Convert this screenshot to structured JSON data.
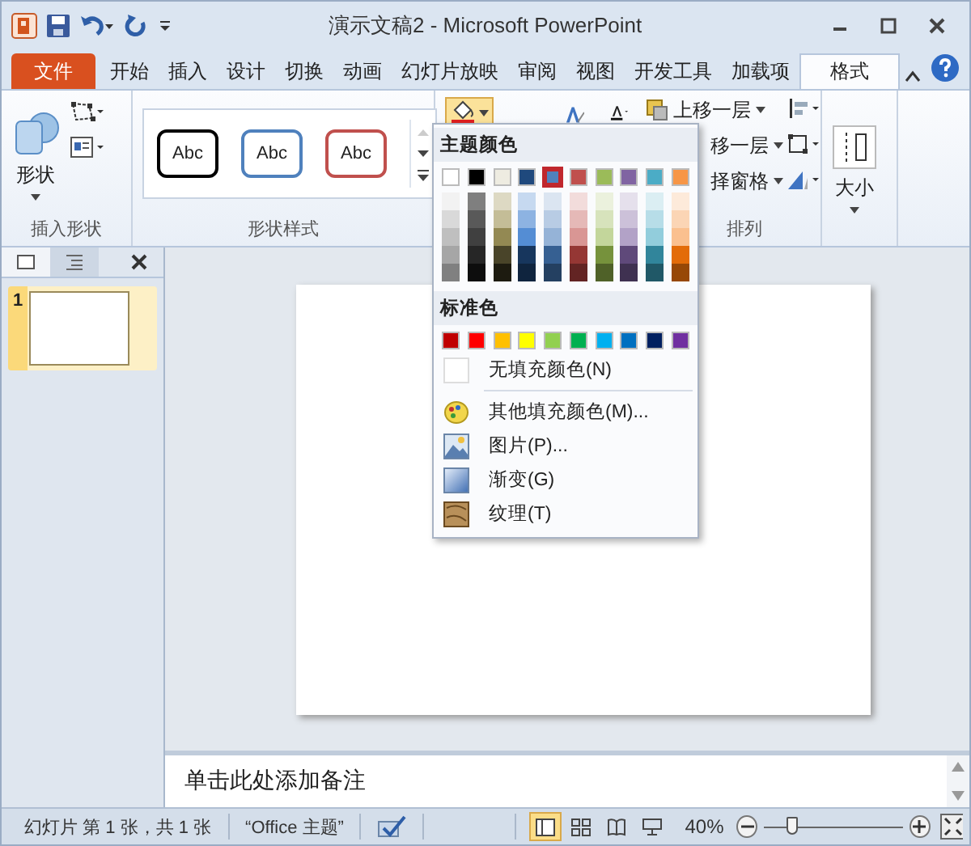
{
  "window": {
    "title": "演示文稿2  -  Microsoft PowerPoint"
  },
  "tabs": [
    {
      "label": "文件",
      "kind": "file",
      "selected": false
    },
    {
      "label": "开始",
      "kind": "tab",
      "selected": false
    },
    {
      "label": "插入",
      "kind": "tab",
      "selected": false
    },
    {
      "label": "设计",
      "kind": "tab",
      "selected": false
    },
    {
      "label": "切换",
      "kind": "tab",
      "selected": false
    },
    {
      "label": "动画",
      "kind": "tab",
      "selected": false
    },
    {
      "label": "幻灯片放映",
      "kind": "tab",
      "selected": false
    },
    {
      "label": "审阅",
      "kind": "tab",
      "selected": false
    },
    {
      "label": "视图",
      "kind": "tab",
      "selected": false
    },
    {
      "label": "开发工具",
      "kind": "tab",
      "selected": false
    },
    {
      "label": "加载项",
      "kind": "tab",
      "selected": false
    },
    {
      "label": "格式",
      "kind": "tab",
      "selected": true
    }
  ],
  "ribbon": {
    "insert_shapes": {
      "label": "插入形状",
      "shapes_button": "形状"
    },
    "shape_styles": {
      "label": "形状样式",
      "styles": [
        {
          "text": "Abc",
          "color": "#000000"
        },
        {
          "text": "Abc",
          "color": "#4f81bd"
        },
        {
          "text": "Abc",
          "color": "#c0504d"
        }
      ]
    },
    "arrange": {
      "label": "排列",
      "items": [
        "上移一层",
        "移一层",
        "择窗格"
      ]
    },
    "size": {
      "label": "大小"
    }
  },
  "fill_menu": {
    "theme_heading": "主题颜色",
    "theme_colors": [
      {
        "color": "#ffffff",
        "selected": false,
        "shades": [
          {
            "color": "#f2f2f2"
          },
          {
            "color": "#d9d9d9"
          },
          {
            "color": "#bfbfbf"
          },
          {
            "color": "#a6a6a6"
          },
          {
            "color": "#808080"
          }
        ]
      },
      {
        "color": "#000000",
        "selected": false,
        "shades": [
          {
            "color": "#7f7f7f"
          },
          {
            "color": "#595959"
          },
          {
            "color": "#404040"
          },
          {
            "color": "#262626"
          },
          {
            "color": "#0d0d0d"
          }
        ]
      },
      {
        "color": "#eeece1",
        "selected": false,
        "shades": [
          {
            "color": "#ddd9c3"
          },
          {
            "color": "#c4bd97"
          },
          {
            "color": "#938953"
          },
          {
            "color": "#494429"
          },
          {
            "color": "#1d1b10"
          }
        ]
      },
      {
        "color": "#1f497d",
        "selected": false,
        "shades": [
          {
            "color": "#c6d9f0"
          },
          {
            "color": "#8db3e2"
          },
          {
            "color": "#548dd4"
          },
          {
            "color": "#17365d"
          },
          {
            "color": "#0f243e"
          }
        ]
      },
      {
        "color": "#4f81bd",
        "selected": true,
        "shades": [
          {
            "color": "#dbe5f1"
          },
          {
            "color": "#b8cce4"
          },
          {
            "color": "#95b3d7"
          },
          {
            "color": "#366092"
          },
          {
            "color": "#244061"
          }
        ]
      },
      {
        "color": "#c0504d",
        "selected": false,
        "shades": [
          {
            "color": "#f2dcdb"
          },
          {
            "color": "#e5b9b7"
          },
          {
            "color": "#d99694"
          },
          {
            "color": "#953734"
          },
          {
            "color": "#632423"
          }
        ]
      },
      {
        "color": "#9bbb59",
        "selected": false,
        "shades": [
          {
            "color": "#ebf1dd"
          },
          {
            "color": "#d7e3bc"
          },
          {
            "color": "#c3d69b"
          },
          {
            "color": "#76923c"
          },
          {
            "color": "#4f6128"
          }
        ]
      },
      {
        "color": "#8064a2",
        "selected": false,
        "shades": [
          {
            "color": "#e5e0ec"
          },
          {
            "color": "#ccc1d9"
          },
          {
            "color": "#b2a2c7"
          },
          {
            "color": "#5f497a"
          },
          {
            "color": "#3f3151"
          }
        ]
      },
      {
        "color": "#4bacc6",
        "selected": false,
        "shades": [
          {
            "color": "#dbeef3"
          },
          {
            "color": "#b7dde8"
          },
          {
            "color": "#92cddc"
          },
          {
            "color": "#31859b"
          },
          {
            "color": "#205867"
          }
        ]
      },
      {
        "color": "#f79646",
        "selected": false,
        "shades": [
          {
            "color": "#fdeada"
          },
          {
            "color": "#fbd5b5"
          },
          {
            "color": "#fac08f"
          },
          {
            "color": "#e36c09"
          },
          {
            "color": "#974806"
          }
        ]
      }
    ],
    "standard_heading": "标准色",
    "standard_colors": [
      {
        "color": "#c00000"
      },
      {
        "color": "#ff0000"
      },
      {
        "color": "#ffc000"
      },
      {
        "color": "#ffff00"
      },
      {
        "color": "#92d050"
      },
      {
        "color": "#00b050"
      },
      {
        "color": "#00b0f0"
      },
      {
        "color": "#0070c0"
      },
      {
        "color": "#002060"
      },
      {
        "color": "#7030a0"
      }
    ],
    "items": [
      {
        "label": "无填充颜色(N)",
        "kind": "none"
      },
      {
        "label": "其他填充颜色(M)...",
        "kind": "more"
      },
      {
        "label": "图片(P)...",
        "kind": "picture"
      },
      {
        "label": "渐变(G)",
        "kind": "gradient"
      },
      {
        "label": "纹理(T)",
        "kind": "texture"
      }
    ]
  },
  "slides_panel": {
    "slides": [
      {
        "number": "1",
        "selected": true
      }
    ]
  },
  "notes": {
    "placeholder": "单击此处添加备注"
  },
  "status_bar": {
    "slide_info": "幻灯片 第 1 张，共 1 张",
    "theme": "“Office 主题”",
    "views": [
      {
        "kind": "normal",
        "selected": true
      },
      {
        "kind": "sorter",
        "selected": false
      },
      {
        "kind": "reading",
        "selected": false
      },
      {
        "kind": "show",
        "selected": false
      }
    ],
    "zoom": "40%",
    "zoom_level": {
      "level": 0.2
    }
  }
}
